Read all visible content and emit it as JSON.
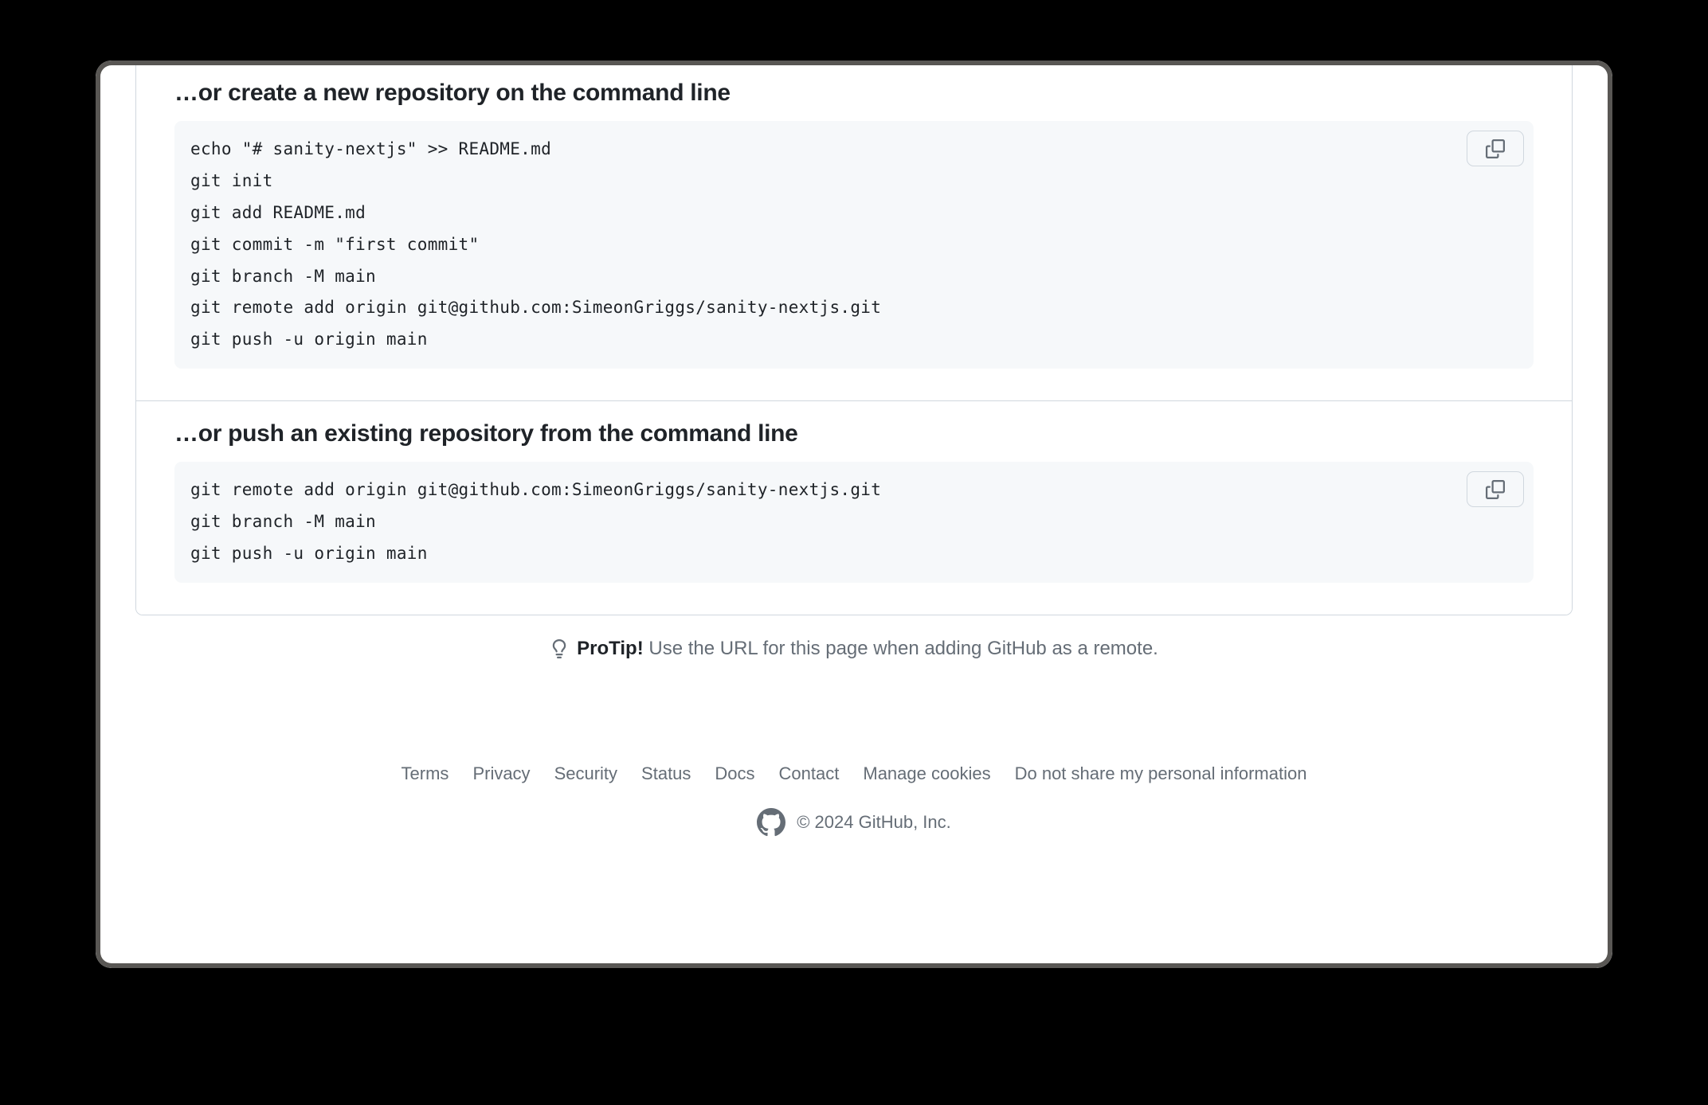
{
  "sections": {
    "create": {
      "heading": "…or create a new repository on the command line",
      "code": "echo \"# sanity-nextjs\" >> README.md\ngit init\ngit add README.md\ngit commit -m \"first commit\"\ngit branch -M main\ngit remote add origin git@github.com:SimeonGriggs/sanity-nextjs.git\ngit push -u origin main"
    },
    "push": {
      "heading": "…or push an existing repository from the command line",
      "code": "git remote add origin git@github.com:SimeonGriggs/sanity-nextjs.git\ngit branch -M main\ngit push -u origin main"
    }
  },
  "protip": {
    "label": "ProTip!",
    "text": "Use the URL for this page when adding GitHub as a remote."
  },
  "footer": {
    "links": [
      "Terms",
      "Privacy",
      "Security",
      "Status",
      "Docs",
      "Contact",
      "Manage cookies",
      "Do not share my personal information"
    ],
    "copyright": "© 2024 GitHub, Inc."
  }
}
